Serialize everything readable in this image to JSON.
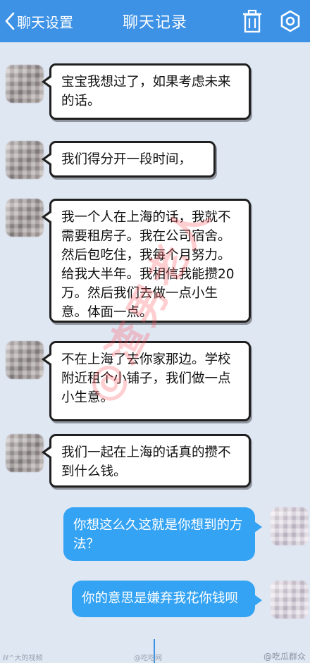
{
  "header": {
    "back_label": "聊天设置",
    "title": "聊天记录",
    "trash_icon": "trash-icon",
    "settings_icon": "gear-icon",
    "bar_color": "#3d92e6"
  },
  "messages": [
    {
      "side": "left",
      "text": "宝宝我想过了，如果考虑未来的话。"
    },
    {
      "side": "left",
      "text": "我们得分开一段时间，"
    },
    {
      "side": "left",
      "text": "我一个人在上海的话，我就不需要租房子。我在公司宿舍。然后包吃住，我每个月努力。给我大半年。我相信我能攒20万。然后我们去做一点小生意。体面一点。"
    },
    {
      "side": "left",
      "text": "不在上海了去你家那边。学校附近租个小铺子，我们做一点小生意。"
    },
    {
      "side": "left",
      "text": "我们一起在上海的话真的攒不到什么钱。"
    },
    {
      "side": "right",
      "text": "你想这么久这就是你想到的方法？"
    },
    {
      "side": "right",
      "text": "你的意思是嫌弃我花你钱呗"
    }
  ],
  "colors": {
    "outgoing_bubble": "#35a3f3",
    "incoming_bubble": "#ffffff",
    "chat_background": "#dfe7f3"
  },
  "watermark": "@渣男老人",
  "footer": {
    "left": "ℓℓ^大的视频",
    "middle": "@吃吃网",
    "right": "@吃瓜群众"
  }
}
